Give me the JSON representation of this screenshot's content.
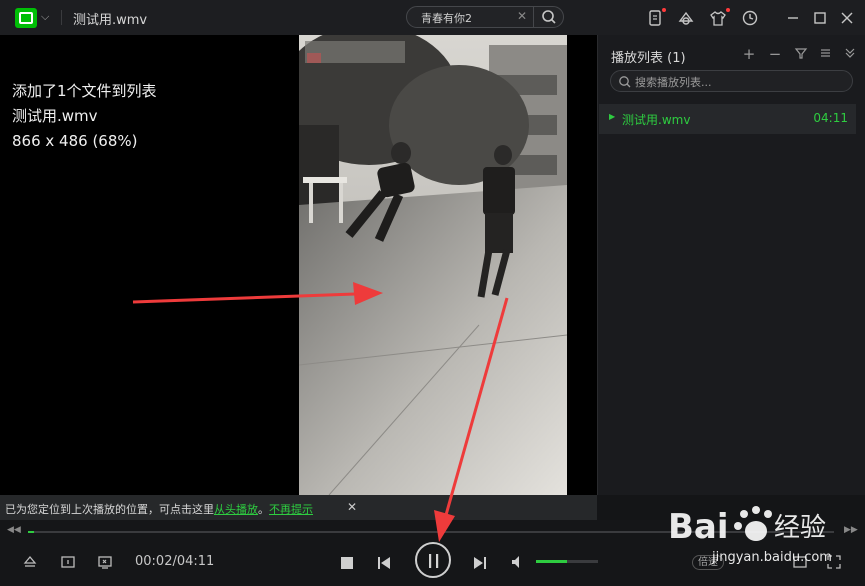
{
  "window": {
    "title": "测试用.wmv"
  },
  "search": {
    "query": "青春有你2"
  },
  "osd": {
    "line1": "添加了1个文件到列表",
    "line2": "测试用.wmv",
    "line3": "866 x 486 (68%)"
  },
  "playlist": {
    "title": "播放列表 (1)",
    "search_placeholder": "搜索播放列表...",
    "items": [
      {
        "name": "测试用.wmv",
        "duration": "04:11"
      }
    ]
  },
  "notice": {
    "text": "已为您定位到上次播放的位置，可点击这里",
    "link1": "从头播放",
    "sep": "。",
    "link2": "不再提示"
  },
  "player": {
    "time": "00:02/04:11",
    "progress_fraction": 0.008,
    "volume_fraction": 0.5,
    "speed_label": "倍速"
  },
  "watermark": {
    "brand": "Bai 百 经验",
    "sub": "jingyan.baidu.com"
  },
  "colors": {
    "accent": "#2ecc40",
    "annotation": "#ee3b3b"
  }
}
